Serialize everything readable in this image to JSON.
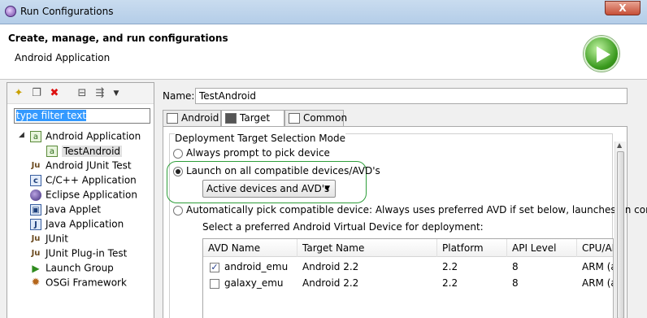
{
  "window": {
    "title": "Run Configurations",
    "close_label": "X"
  },
  "header": {
    "title": "Create, manage, and run configurations",
    "subtitle": "Android Application",
    "run_icon": "run-play-icon",
    "run_icon_color": "#3a9a1e"
  },
  "left": {
    "toolbar_icons": [
      "new-config-icon",
      "duplicate-icon",
      "delete-icon",
      "collapse-all-icon",
      "filter-icon",
      "view-menu-icon"
    ],
    "filter_placeholder": "type filter text",
    "tree": [
      {
        "label": "Android Application",
        "icon": "android-app-icon",
        "expanded": true
      },
      {
        "label": "TestAndroid",
        "icon": "android-config-icon",
        "selected": true
      },
      {
        "label": "Android JUnit Test",
        "icon": "junit-icon"
      },
      {
        "label": "C/C++ Application",
        "icon": "c-app-icon"
      },
      {
        "label": "Eclipse Application",
        "icon": "eclipse-icon"
      },
      {
        "label": "Java Applet",
        "icon": "java-applet-icon"
      },
      {
        "label": "Java Application",
        "icon": "java-app-icon"
      },
      {
        "label": "JUnit",
        "icon": "junit-icon"
      },
      {
        "label": "JUnit Plug-in Test",
        "icon": "junit-plugin-icon"
      },
      {
        "label": "Launch Group",
        "icon": "launch-group-icon"
      },
      {
        "label": "OSGi Framework",
        "icon": "osgi-icon"
      }
    ]
  },
  "right": {
    "name_label": "Name:",
    "name_value": "TestAndroid",
    "tabs": [
      {
        "label": "Android",
        "active": false
      },
      {
        "label": "Target",
        "active": true
      },
      {
        "label": "Common",
        "active": false
      }
    ],
    "group_title": "Deployment Target Selection Mode",
    "radio_prompt": "Always prompt to pick device",
    "radio_launch_all": "Launch on all compatible devices/AVD's",
    "combo_value": "Active devices and AVD's",
    "radio_auto": "Automatically pick compatible device: Always uses preferred AVD if set below, launches on compati",
    "avd_select_label": "Select a preferred Android Virtual Device for deployment:",
    "avd_table": {
      "columns": [
        "AVD Name",
        "Target Name",
        "Platform",
        "API Level",
        "CPU/AB"
      ],
      "rows": [
        {
          "checked": true,
          "name": "android_emu",
          "target": "Android 2.2",
          "platform": "2.2",
          "api": "8",
          "cpu": "ARM (a"
        },
        {
          "checked": false,
          "name": "galaxy_emu",
          "target": "Android 2.2",
          "platform": "2.2",
          "api": "8",
          "cpu": "ARM (a"
        }
      ]
    },
    "highlight_color": "#2e9e3a"
  }
}
